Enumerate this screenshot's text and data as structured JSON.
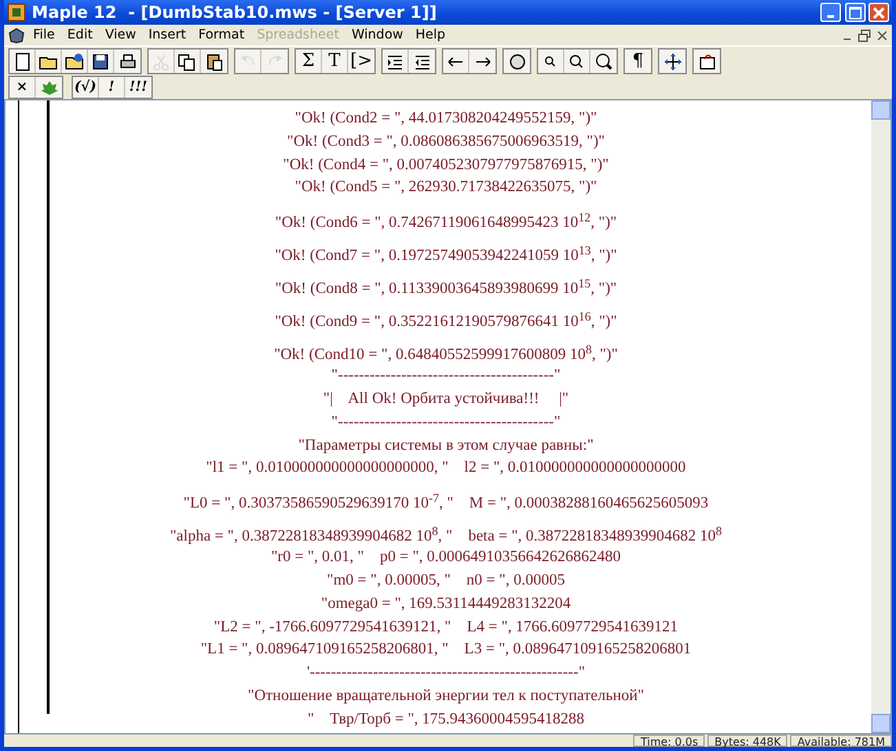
{
  "window": {
    "title": "Maple 12  - [DumbStab10.mws - [Server 1]]"
  },
  "menu": [
    {
      "label": "File",
      "disabled": false
    },
    {
      "label": "Edit",
      "disabled": false
    },
    {
      "label": "View",
      "disabled": false
    },
    {
      "label": "Insert",
      "disabled": false
    },
    {
      "label": "Format",
      "disabled": false
    },
    {
      "label": "Spreadsheet",
      "disabled": true
    },
    {
      "label": "Window",
      "disabled": false
    },
    {
      "label": "Help",
      "disabled": false
    }
  ],
  "toolbar": [
    [
      {
        "disabled": false
      },
      {
        "disabled": false
      },
      {
        "disabled": false
      },
      {
        "disabled": false
      },
      {
        "disabled": false
      }
    ],
    [
      {
        "disabled": true
      },
      {
        "disabled": false
      },
      {
        "disabled": false
      }
    ],
    [
      {
        "disabled": true
      },
      {
        "disabled": true
      }
    ],
    [
      {
        "label": "Σ",
        "disabled": false
      },
      {
        "label": "T",
        "disabled": false
      },
      {
        "label": "[>",
        "disabled": false
      }
    ],
    [
      {
        "disabled": false
      },
      {
        "disabled": false
      }
    ],
    [
      {
        "disabled": false
      },
      {
        "disabled": false
      }
    ],
    [
      {
        "disabled": false
      }
    ],
    [
      {
        "disabled": false
      },
      {
        "disabled": false
      },
      {
        "disabled": false
      }
    ],
    [
      {
        "label": "¶",
        "disabled": false
      }
    ],
    [
      {
        "disabled": false
      }
    ],
    [
      {
        "disabled": false
      }
    ]
  ],
  "context_toolbar": [
    [
      {
        "kind": "text",
        "label": "×"
      },
      {
        "kind": "icon"
      }
    ],
    [
      {
        "kind": "text",
        "label": "(√)"
      },
      {
        "kind": "text",
        "label": "!"
      },
      {
        "kind": "text",
        "label": "!!!"
      }
    ]
  ],
  "output_lines": [
    "\"Ok! (Cond2 = \", 44.017308204249552159, \")\"",
    "\"Ok! (Cond3 = \", 0.086086385675006963519, \")\"",
    "\"Ok! (Cond4 = \", 0.0074052307977975876915, \")\"",
    "\"Ok! (Cond5 = \", 262930.71738422635075, \")\"",
    "\"Ok! (Cond6 = \", 0.74267119061648995423 10$^{12}$, \")\"",
    "\"Ok! (Cond7 = \", 0.19725749053942241059 10$^{13}$, \")\"",
    "\"Ok! (Cond8 = \", 0.11339003645893980699 10$^{15}$, \")\"",
    "\"Ok! (Cond9 = \", 0.35221612190579876641 10$^{16}$, \")\"",
    "\"Ok! (Cond10 = \", 0.64840552599917600809 10$^{8}$, \")\"",
    "\"-----------------------------------------\"",
    "\"|    All Ok! Орбита устойчива!!!     |\"",
    "\"-----------------------------------------\"",
    "\"Параметры системы в этом случае равны:\"",
    "\"l1 = \", 0.010000000000000000000, \"    l2 = \", 0.010000000000000000000",
    "\"L0 = \", 0.30373586590529639170 10$^{-7}$, \"    M = \", 0.00038288160465625605093",
    "\"alpha = \", 0.38722818348939904682 10$^{8}$, \"    beta = \", 0.38722818348939904682 10$^{8}$",
    "\"r0 = \", 0.01, \"    p0 = \", 0.00064910356642626862480",
    "\"m0 = \", 0.00005, \"    n0 = \", 0.00005",
    "\"omega0 = \", 169.53114449283132204",
    "\"L2 = \", -1766.6097729541639121, \"    L4 = \", 1766.6097729541639121",
    "\"L1 = \", 0.089647109165258206801, \"    L3 = \", 0.089647109165258206801",
    "'---------------------------------------------------\"",
    "\"Отношение вращательной энергии тел к поступательной\"",
    "\"    Твр/Торб = \", 175.94360004595418288"
  ],
  "status_bar": [
    "Time: 0.0s",
    "Bytes: 448K",
    "Available: 781M"
  ]
}
